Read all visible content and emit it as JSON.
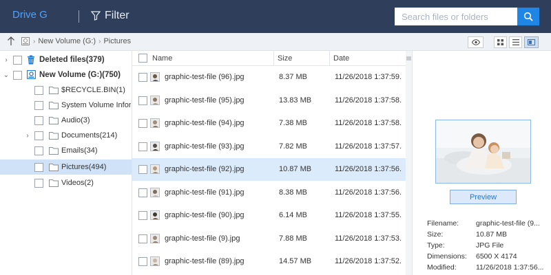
{
  "header": {
    "drive_label": "Drive G",
    "filter_label": "Filter",
    "search_placeholder": "Search files or folders"
  },
  "breadcrumb": {
    "segments": [
      "New Volume (G:)",
      "Pictures"
    ]
  },
  "tree": {
    "items": [
      {
        "label": "Deleted files(379)",
        "icon": "trash-icon",
        "bold": true
      },
      {
        "label": "New Volume (G:)(750)",
        "icon": "drive-icon",
        "bold": true
      },
      {
        "label": "$RECYCLE.BIN(1)",
        "icon": "folder-icon"
      },
      {
        "label": "System Volume Informati",
        "icon": "folder-icon"
      },
      {
        "label": "Audio(3)",
        "icon": "folder-icon"
      },
      {
        "label": "Documents(214)",
        "icon": "folder-icon"
      },
      {
        "label": "Emails(34)",
        "icon": "folder-icon"
      },
      {
        "label": "Pictures(494)",
        "icon": "folder-icon",
        "selected": true
      },
      {
        "label": "Videos(2)",
        "icon": "folder-icon"
      }
    ]
  },
  "list": {
    "columns": {
      "name": "Name",
      "size": "Size",
      "date": "Date"
    },
    "rows": [
      {
        "name": "graphic-test-file (96).jpg",
        "size": "8.37 MB",
        "date": "11/26/2018 1:37:59."
      },
      {
        "name": "graphic-test-file (95).jpg",
        "size": "13.83 MB",
        "date": "11/26/2018 1:37:58."
      },
      {
        "name": "graphic-test-file (94).jpg",
        "size": "7.38 MB",
        "date": "11/26/2018 1:37:58."
      },
      {
        "name": "graphic-test-file (93).jpg",
        "size": "7.82 MB",
        "date": "11/26/2018 1:37:57."
      },
      {
        "name": "graphic-test-file (92).jpg",
        "size": "10.87 MB",
        "date": "11/26/2018 1:37:56.",
        "selected": true
      },
      {
        "name": "graphic-test-file (91).jpg",
        "size": "8.38 MB",
        "date": "11/26/2018 1:37:56."
      },
      {
        "name": "graphic-test-file (90).jpg",
        "size": "6.14 MB",
        "date": "11/26/2018 1:37:55."
      },
      {
        "name": "graphic-test-file (9).jpg",
        "size": "7.88 MB",
        "date": "11/26/2018 1:37:53."
      },
      {
        "name": "graphic-test-file (89).jpg",
        "size": "14.57 MB",
        "date": "11/26/2018 1:37:52."
      }
    ]
  },
  "preview": {
    "button_label": "Preview",
    "fields": [
      {
        "key": "Filename:",
        "value": "graphic-test-file (9..."
      },
      {
        "key": "Size:",
        "value": "10.87 MB"
      },
      {
        "key": "Type:",
        "value": "JPG File"
      },
      {
        "key": "Dimensions:",
        "value": "6500 X 4174"
      },
      {
        "key": "Modified:",
        "value": "11/26/2018 1:37:56..."
      }
    ]
  },
  "colors": {
    "header_bg": "#2f3e5a",
    "accent": "#1f86e5",
    "selection": "#cfe2f7"
  }
}
